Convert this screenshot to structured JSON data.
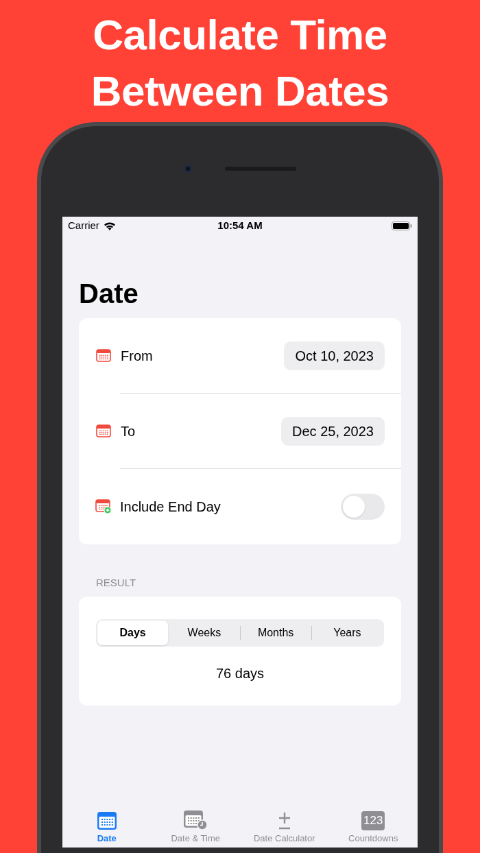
{
  "headline": [
    "Calculate Time",
    "Between Dates"
  ],
  "status_bar": {
    "carrier": "Carrier",
    "time": "10:54 AM"
  },
  "title": "Date",
  "rows": [
    {
      "kind": "date",
      "label": "From",
      "value": "Oct 10, 2023"
    },
    {
      "kind": "date",
      "label": "To",
      "value": "Dec 25, 2023"
    },
    {
      "kind": "toggle",
      "label": "Include End Day",
      "on": false
    }
  ],
  "result": {
    "header": "RESULT",
    "segments": [
      {
        "label": "Days",
        "selected": true
      },
      {
        "label": "Weeks",
        "selected": false
      },
      {
        "label": "Months",
        "selected": false
      },
      {
        "label": "Years",
        "selected": false
      }
    ],
    "value": "76 days"
  },
  "tab_bar": [
    {
      "kind": "calendar",
      "label": "Date",
      "selected": true
    },
    {
      "kind": "calendar-clock",
      "label": "Date & Time",
      "selected": false
    },
    {
      "kind": "plus-minus",
      "label": "Date Calculator",
      "selected": false
    },
    {
      "kind": "number",
      "icon_text": "123",
      "label": "Countdowns",
      "selected": false
    }
  ]
}
